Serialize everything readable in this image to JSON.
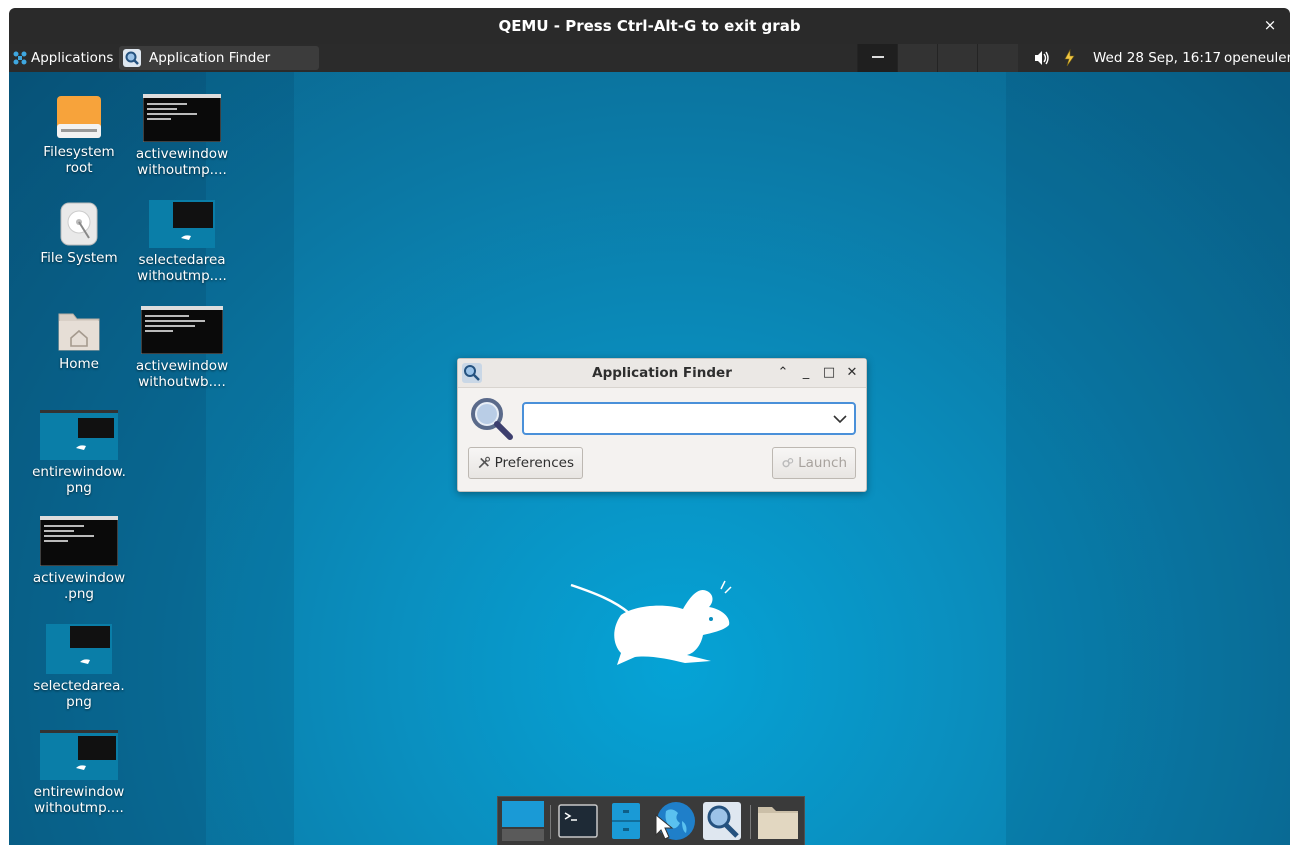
{
  "qemu": {
    "title": "QEMU - Press Ctrl-Alt-G to exit grab",
    "close_glyph": "×"
  },
  "panel": {
    "applications_label": "Applications",
    "task_label": "Application Finder",
    "clock": "Wed 28 Sep, 16:17",
    "user": "openeuler"
  },
  "desktop_icons": [
    {
      "label1": "Filesystem",
      "label2": "root",
      "icon": "drive-orange-icon"
    },
    {
      "label1": "File System",
      "label2": "",
      "icon": "harddisk-icon"
    },
    {
      "label1": "Home",
      "label2": "",
      "icon": "home-folder-icon"
    },
    {
      "label1": "entirewindow.",
      "label2": "png",
      "icon": "image-thumbnail"
    },
    {
      "label1": "activewindow",
      "label2": ".png",
      "icon": "image-thumbnail"
    },
    {
      "label1": "selectedarea.",
      "label2": "png",
      "icon": "image-thumbnail"
    },
    {
      "label1": "entirewindow",
      "label2": "withoutmp....",
      "icon": "image-thumbnail"
    },
    {
      "label1": "activewindow",
      "label2": "withoutmp....",
      "icon": "image-thumbnail"
    },
    {
      "label1": "selectedarea",
      "label2": "withoutmp....",
      "icon": "image-thumbnail"
    },
    {
      "label1": "activewindow",
      "label2": "withoutwb....",
      "icon": "image-thumbnail"
    }
  ],
  "app_finder": {
    "title": "Application Finder",
    "search_value": "",
    "preferences_label": "Preferences",
    "launch_label": "Launch"
  },
  "dock": {
    "items": [
      "show-desktop-icon",
      "terminal-icon",
      "file-manager-icon",
      "web-browser-icon",
      "app-finder-icon",
      "folder-icon"
    ]
  },
  "colors": {
    "desktop": "#0a8fbf",
    "panel": "#2b2b2b",
    "focus": "#4a90d9"
  }
}
